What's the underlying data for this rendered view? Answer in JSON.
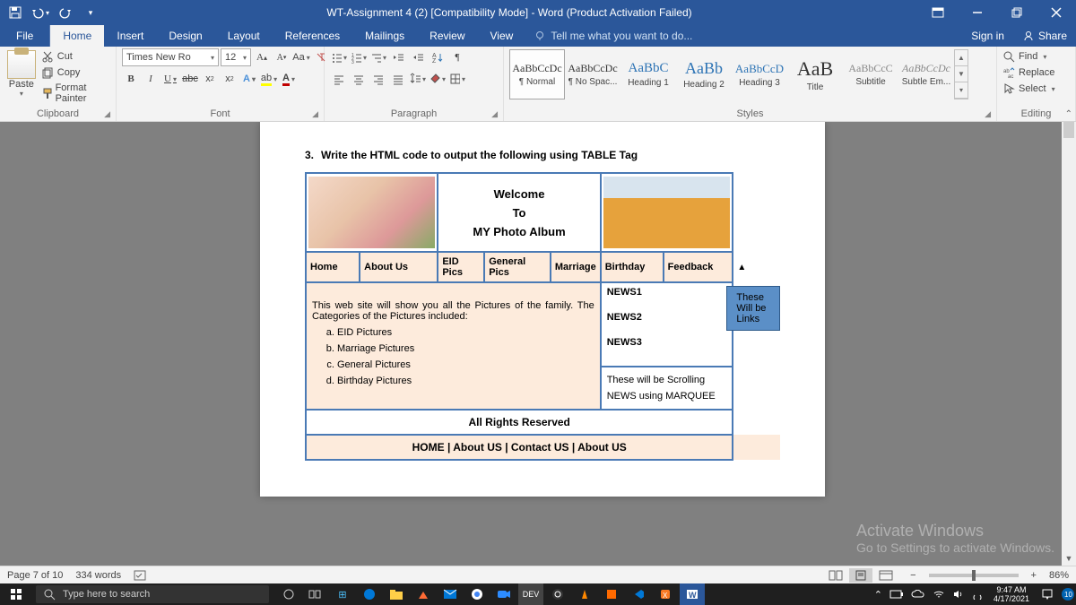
{
  "title": "WT-Assignment 4 (2) [Compatibility Mode] - Word (Product Activation Failed)",
  "ribbon_tabs": {
    "file": "File",
    "home": "Home",
    "insert": "Insert",
    "design": "Design",
    "layout": "Layout",
    "references": "References",
    "mailings": "Mailings",
    "review": "Review",
    "view": "View",
    "tell_me": "Tell me what you want to do...",
    "sign_in": "Sign in",
    "share": "Share"
  },
  "clipboard": {
    "paste": "Paste",
    "cut": "Cut",
    "copy": "Copy",
    "format_painter": "Format Painter",
    "label": "Clipboard"
  },
  "font": {
    "name": "Times New Ro",
    "size": "12",
    "label": "Font"
  },
  "paragraph": {
    "label": "Paragraph"
  },
  "styles": {
    "label": "Styles",
    "items": [
      {
        "prev": "AaBbCcDc",
        "name": "¶ Normal",
        "size": "12px",
        "color": "#333"
      },
      {
        "prev": "AaBbCcDc",
        "name": "¶ No Spac...",
        "size": "12px",
        "color": "#333"
      },
      {
        "prev": "AaBbC",
        "name": "Heading 1",
        "size": "15px",
        "color": "#2e74b5"
      },
      {
        "prev": "AaBb",
        "name": "Heading 2",
        "size": "18px",
        "color": "#2e74b5"
      },
      {
        "prev": "AaBbCcD",
        "name": "Heading 3",
        "size": "13px",
        "color": "#2e74b5"
      },
      {
        "prev": "AaB",
        "name": "Title",
        "size": "22px",
        "color": "#333"
      },
      {
        "prev": "AaBbCcC",
        "name": "Subtitle",
        "size": "12px",
        "color": "#888"
      },
      {
        "prev": "AaBbCcDc",
        "name": "Subtle Em...",
        "size": "12px",
        "color": "#888",
        "italic": true
      }
    ]
  },
  "editing": {
    "find": "Find",
    "replace": "Replace",
    "select": "Select",
    "label": "Editing"
  },
  "document": {
    "q_num": "3.",
    "q_text": "Write the HTML code to output the following using TABLE Tag",
    "welcome": "Welcome",
    "to": "To",
    "album": "MY Photo Album",
    "nav": [
      "Home",
      "About Us",
      "EID Pics",
      "General Pics",
      "Marriage",
      "Birthday",
      "Feedback"
    ],
    "body_p1": "This web site will show you all the Pictures of the family. The Categories of the Pictures included:",
    "body_li": [
      "EID Pictures",
      "Marriage Pictures",
      "General Pictures",
      "Birthday Pictures"
    ],
    "news": [
      "NEWS1",
      "NEWS2",
      "NEWS3"
    ],
    "callout1": "These Will be Links",
    "callout2a": "These will be Scrolling",
    "callout2b": "NEWS using MARQUEE",
    "footer1": "All Rights Reserved",
    "footer2": "HOME | About US | Contact US | About US"
  },
  "activate": {
    "l1": "Activate Windows",
    "l2": "Go to Settings to activate Windows."
  },
  "status": {
    "page": "Page 7 of 10",
    "words": "334 words",
    "zoom": "86%"
  },
  "taskbar": {
    "search_ph": "Type here to search",
    "time": "9:47 AM",
    "date": "4/17/2021"
  }
}
